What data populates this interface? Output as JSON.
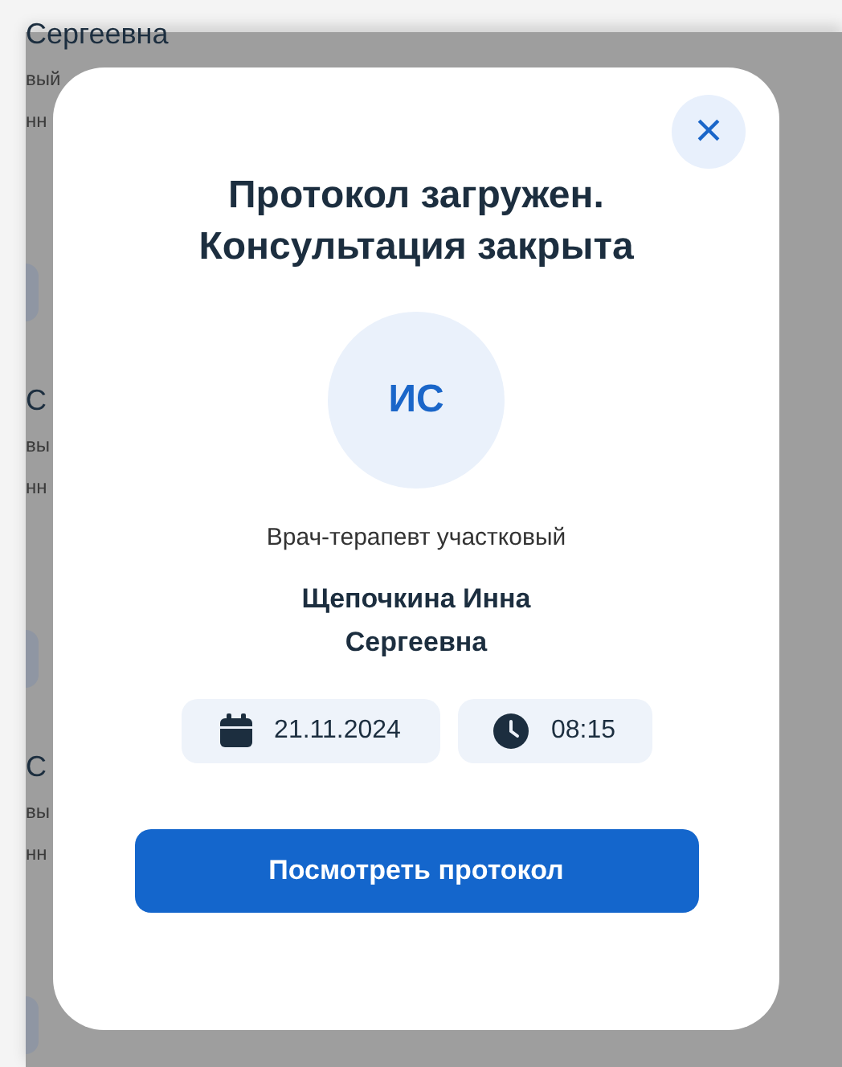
{
  "background_cards": [
    {
      "name": "Сергеевна",
      "line_2": "вый",
      "line_3": "нн"
    },
    {
      "name": "С",
      "line_2": "вы",
      "line_3": "нн"
    },
    {
      "name": "С",
      "line_2": "вы",
      "line_3": "нн"
    }
  ],
  "modal": {
    "close": "×",
    "title": "Протокол загружен. Консультация закрыта",
    "initials": "ИС",
    "specialty": "Врач-терапевт участковый",
    "doctor": "Щепочкина Инна Сергеевна",
    "date": "21.11.2024",
    "time": "08:15",
    "button": "Посмотреть протокол"
  }
}
